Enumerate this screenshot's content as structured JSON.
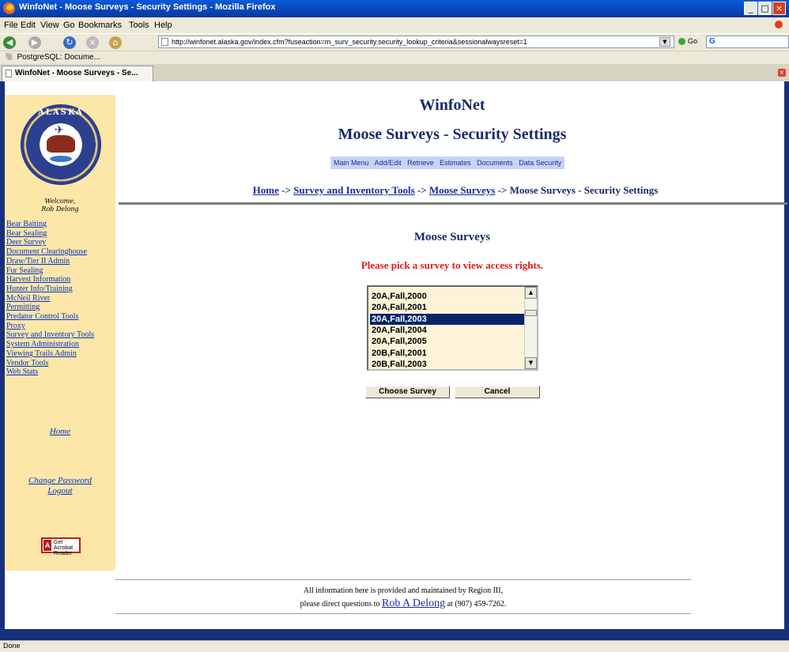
{
  "window": {
    "title": "WinfoNet - Moose Surveys - Security Settings - Mozilla Firefox",
    "minimize": "_",
    "maximize": "□",
    "close": "×"
  },
  "menu": [
    "File",
    "Edit",
    "View",
    "Go",
    "Bookmarks",
    "Tools",
    "Help"
  ],
  "toolbar": {
    "url": "http://winfonet.alaska.gov/index.cfm?fuseaction=m_surv_security.security_lookup_criteria&sessionalwaysreset=1",
    "go_label": "Go",
    "search_placeholder": "G"
  },
  "bookmarks": [
    "PostgreSQL: Docume..."
  ],
  "tab": {
    "label": "WinfoNet - Moose Surveys - Se..."
  },
  "sidebar": {
    "seal_text": "ALASKA",
    "welcome_line1": "Welcome,",
    "welcome_line2": "Rob Delong",
    "links": [
      "Bear Baiting",
      "Bear Sealing",
      "Deer Survey",
      "Document Clearinghouse",
      "Draw/Tier II Admin",
      "Fur Sealing",
      "Harvest Information",
      "Hunter Info/Training",
      "McNeil River",
      "Permitting",
      "Predator Control Tools",
      "Proxy",
      "Survey and Inventory Tools",
      "System Administration",
      "Viewing Trails Admin",
      "Vendor Tools",
      "Web Stats"
    ],
    "home": "Home",
    "change_password": "Change Password",
    "logout": "Logout",
    "acrobat_line1": "Get",
    "acrobat_line2": "Acrobat",
    "acrobat_line3": "Reader"
  },
  "main": {
    "title": "WinfoNet",
    "subtitle": "Moose Surveys - Security Settings",
    "topnav": [
      "Main Menu",
      "Add/Edit",
      "Retrieve",
      "Estimates",
      "Documents",
      "Data Security"
    ],
    "breadcrumb": {
      "home": "Home",
      "sep": " -> ",
      "survey_tools": "Survey and Inventory Tools",
      "moose": "Moose Surveys",
      "current": "Moose Surveys - Security Settings"
    },
    "section_title": "Moose Surveys",
    "instruction": "Please pick a survey to view access rights.",
    "survey_options": [
      "20A,Fall,2000",
      "20A,Fall,2001",
      "20A,Fall,2003",
      "20A,Fall,2004",
      "20A,Fall,2005",
      "20B,Fall,2001",
      "20B,Fall,2003"
    ],
    "selected_option": "20A,Fall,2003",
    "choose_button": "Choose Survey",
    "cancel_button": "Cancel"
  },
  "footer": {
    "line1": "All information here is provided and maintained by Region III,",
    "line2_prefix": "please direct questions to ",
    "contact_name": "Rob A Delong",
    "line2_suffix": " at (907) 459-7262."
  },
  "status": {
    "text": "Done"
  }
}
